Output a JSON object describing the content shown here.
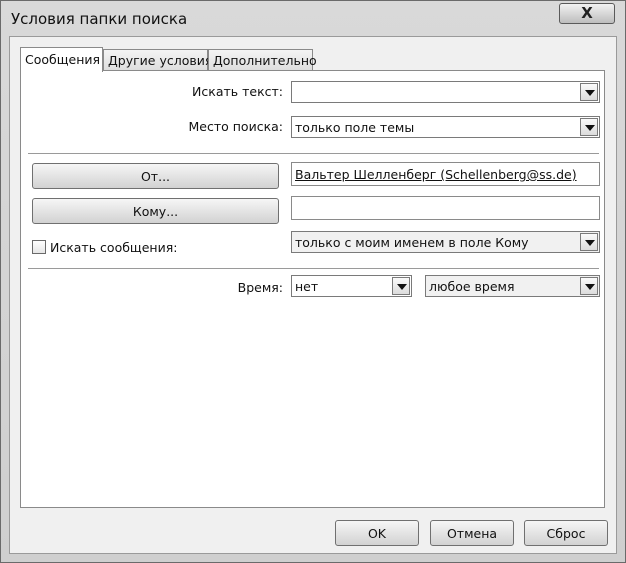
{
  "window": {
    "title": "Условия папки поиска",
    "close_label": "X"
  },
  "tabs": [
    {
      "label": "Сообщения",
      "active": true
    },
    {
      "label": "Другие условия",
      "active": false
    },
    {
      "label": "Дополнительно",
      "active": false
    }
  ],
  "messages": {
    "search_text_label": "Искать текст:",
    "search_text_value": "",
    "search_in_label": "Место поиска:",
    "search_in_value": "только поле темы",
    "from_button_label": "От...",
    "from_value": "Вальтер Шелленберг (Schellenberg@ss.de)",
    "to_button_label": "Кому...",
    "to_value": "",
    "where_checkbox_label": "Искать сообщения:",
    "where_checkbox_checked": false,
    "where_value": "только с моим именем в поле Кому",
    "time_label": "Время:",
    "time_field_value": "нет",
    "time_range_value": "любое время"
  },
  "footer": {
    "ok_label": "OK",
    "cancel_label": "Отмена",
    "reset_label": "Сброс"
  }
}
